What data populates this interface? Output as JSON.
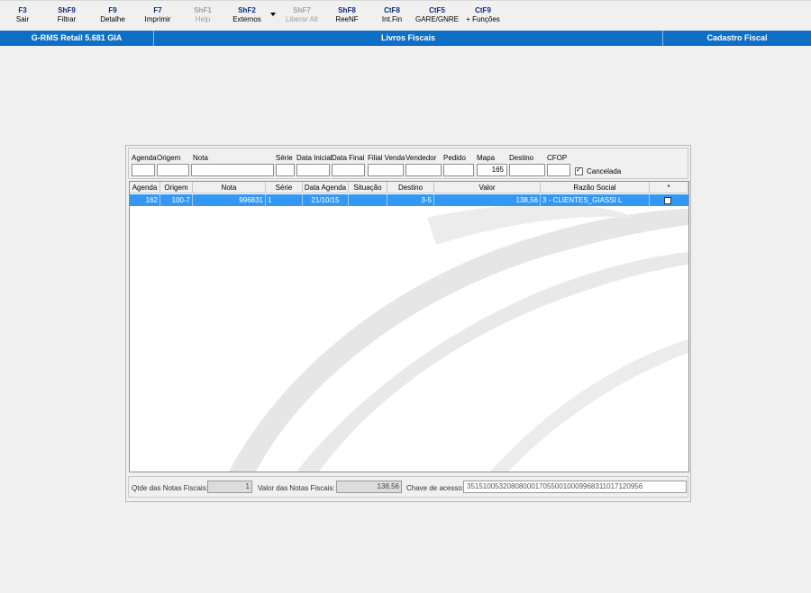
{
  "toolbar": {
    "items": [
      {
        "key": "F3",
        "label": "Sair",
        "enabled": true
      },
      {
        "key": "ShF9",
        "label": "Filtrar",
        "enabled": true
      },
      {
        "key": "F9",
        "label": "Detalhe",
        "enabled": true
      },
      {
        "key": "F7",
        "label": "Imprimir",
        "enabled": true
      },
      {
        "key": "ShF1",
        "label": "Help",
        "enabled": false
      },
      {
        "key": "ShF2",
        "label": "Externos",
        "enabled": true
      },
      {
        "key": "ShF7",
        "label": "Liberar Alt",
        "enabled": false
      },
      {
        "key": "ShF8",
        "label": "ReeNF",
        "enabled": true
      },
      {
        "key": "CtF8",
        "label": "Int.Fin",
        "enabled": true
      },
      {
        "key": "CtF5",
        "label": "GARE/GNRE",
        "enabled": true
      },
      {
        "key": "CtF9",
        "label": "+ Funções",
        "enabled": true
      }
    ]
  },
  "titlebar": {
    "app": "G-RMS Retail 5.681 GIA",
    "module": "Livros Fiscais",
    "screen": "Cadastro Fiscal"
  },
  "filters": {
    "labels": {
      "agenda": "Agenda",
      "origem": "Origem",
      "nota": "Nota",
      "serie": "Série",
      "data_inicial": "Data Inicial",
      "data_final": "Data Final",
      "filial_venda": "Filial Venda",
      "vendedor": "Vendedor",
      "pedido": "Pedido",
      "mapa": "Mapa",
      "destino": "Destino",
      "cfop": "CFOP"
    },
    "values": {
      "agenda": "",
      "origem": "",
      "nota": "",
      "serie": "",
      "data_inicial": "",
      "data_final": "",
      "filial_venda": "",
      "vendedor": "",
      "pedido": "",
      "mapa": "165",
      "destino": "",
      "cfop": ""
    },
    "cancelada_label": "Cancelada",
    "cancelada_checked": true
  },
  "grid": {
    "columns": [
      "Agenda",
      "Origem",
      "Nota",
      "Série",
      "Data Agenda",
      "Situação",
      "Destino",
      "Valor",
      "Razão Social",
      "*"
    ],
    "rows": [
      {
        "agenda": "162",
        "origem": "100-7",
        "nota": "996831",
        "serie": "1",
        "data_agenda": "21/10/15",
        "situacao": "",
        "destino": "3-5",
        "valor": "138,56",
        "razao_social": "3 - CLIENTES_GIASSI L",
        "selected": true
      }
    ]
  },
  "footer": {
    "qtde_label": "Qtde das Notas Fiscais:",
    "qtde_value": "1",
    "valor_label": "Valor  das Notas Fiscais:",
    "valor_value": "138,56",
    "chave_label": "Chave de acesso:",
    "chave_value": "35151005320808000170550010009968311017120956"
  },
  "colors": {
    "titlebar_bg": "#0f6fc6",
    "selected_row": "#3398f3",
    "hotkey": "#0b2a7a"
  }
}
